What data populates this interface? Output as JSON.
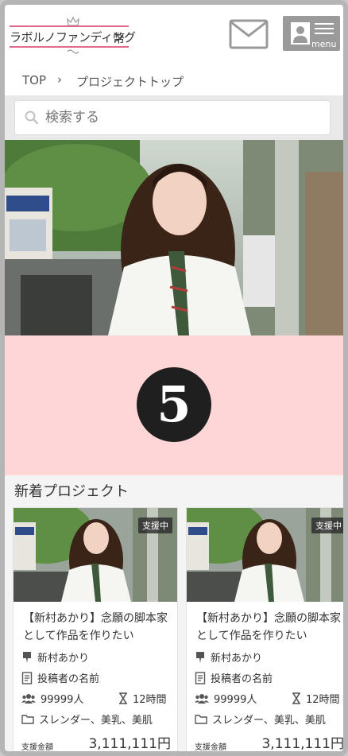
{
  "header": {
    "logo_text": "ラボルノファンディング",
    "menu_label": "menu"
  },
  "breadcrumb": {
    "top": "TOP",
    "separator": "›",
    "current": "プロジェクトトップ"
  },
  "search": {
    "placeholder": "検索する"
  },
  "banner": {
    "number": "5"
  },
  "section": {
    "title": "新着プロジェクト"
  },
  "projects": [
    {
      "badge": "支援中",
      "title": "【新村あかり】念願の脚本家として作品を作りたい",
      "creator": "新村あかり",
      "poster": "投稿者の名前",
      "supporters": "99999人",
      "time_left": "12時間",
      "tags": "スレンダー、美乳、美肌",
      "amount_label": "支援金額",
      "amount": "3,111,111円"
    },
    {
      "badge": "支援中",
      "title": "【新村あかり】念願の脚本家として作品を作りたい",
      "creator": "新村あかり",
      "poster": "投稿者の名前",
      "supporters": "99999人",
      "time_left": "12時間",
      "tags": "スレンダー、美乳、美肌",
      "amount_label": "支援金額",
      "amount": "3,111,111円"
    }
  ],
  "colors": {
    "pink_banner": "#ffd6d8",
    "logo_accent": "#e06a8a",
    "menu_button": "#9a9a9a"
  }
}
